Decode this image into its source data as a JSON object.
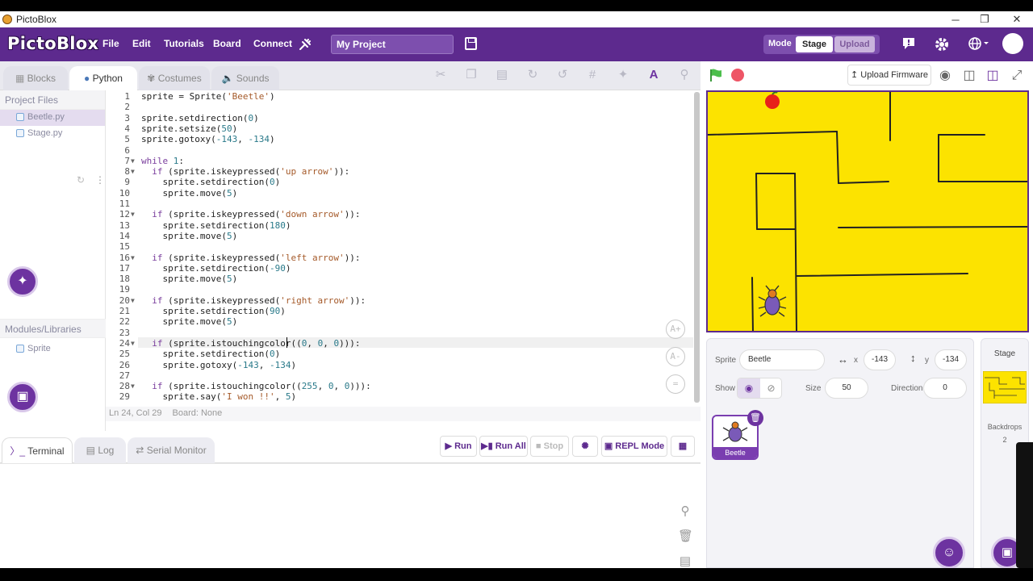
{
  "window": {
    "title": "PictoBlox",
    "controls": [
      "─",
      "❐",
      "✕"
    ]
  },
  "menubar": {
    "logo": "PictoBlox",
    "items": [
      "File",
      "Edit",
      "Tutorials",
      "Board",
      "Connect"
    ],
    "project_name": "My Project",
    "mode_label": "Mode",
    "mode_stage": "Stage",
    "mode_upload": "Upload"
  },
  "left_tabs": [
    "Blocks",
    "Python",
    "Costumes",
    "Sounds"
  ],
  "project_files": {
    "header": "Project Files",
    "files": [
      "Beetle.py",
      "Stage.py"
    ],
    "modules_header": "Modules/Libraries",
    "modules": [
      "Sprite"
    ]
  },
  "editor": {
    "line_numbers": [
      "1",
      "2",
      "3",
      "4",
      "5",
      "6",
      "7",
      "8",
      "9",
      "10",
      "11",
      "12",
      "13",
      "14",
      "15",
      "16",
      "17",
      "18",
      "19",
      "20",
      "21",
      "22",
      "23",
      "24",
      "25",
      "26",
      "27",
      "28",
      "29"
    ],
    "code": [
      "sprite = Sprite('Beetle')",
      "",
      "sprite.setdirection(0)",
      "sprite.setsize(50)",
      "sprite.gotoxy(-143, -134)",
      "",
      "while 1:",
      "  if (sprite.iskeypressed('up arrow')):",
      "    sprite.setdirection(0)",
      "    sprite.move(5)",
      "",
      "  if (sprite.iskeypressed('down arrow')):",
      "    sprite.setdirection(180)",
      "    sprite.move(5)",
      "",
      "  if (sprite.iskeypressed('left arrow')):",
      "    sprite.setdirection(-90)",
      "    sprite.move(5)",
      "",
      "  if (sprite.iskeypressed('right arrow')):",
      "    sprite.setdirection(90)",
      "    sprite.move(5)",
      "",
      "  if (sprite.istouchingcolor((0, 0, 0))):",
      "    sprite.setdirection(0)",
      "    sprite.gotoxy(-143, -134)",
      "",
      "  if (sprite.istouchingcolor((255, 0, 0))):",
      "    sprite.say('I won !!', 5)"
    ],
    "status": "Ln 24, Col 29",
    "board_status": "Board: None"
  },
  "bottom_tabs": [
    "Terminal",
    "Log",
    "Serial Monitor"
  ],
  "run_buttons": {
    "run": "Run",
    "run_all": "Run All",
    "stop": "Stop",
    "repl": "REPL Mode"
  },
  "upload_firmware": "Upload Firmware",
  "sprite_info": {
    "sprite_label": "Sprite",
    "sprite_name": "Beetle",
    "x_label": "x",
    "x_value": "-143",
    "y_label": "y",
    "y_value": "-134",
    "show_label": "Show",
    "size_label": "Size",
    "size_value": "50",
    "direction_label": "Direction",
    "direction_value": "0",
    "tile_name": "Beetle"
  },
  "stage_panel": {
    "title": "Stage",
    "backdrops_label": "Backdrops",
    "backdrops_count": "2"
  },
  "colors": {
    "brand": "#5d2a8e",
    "stage_bg": "#fce300",
    "accent_light": "#e4dcef"
  }
}
